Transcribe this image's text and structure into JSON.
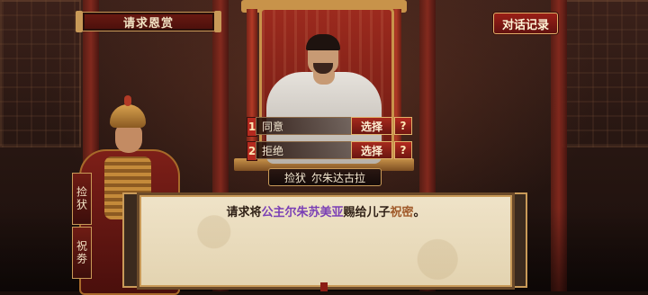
{
  "header": {
    "title": "请求恩赏",
    "dialog_log_label": "对话记录"
  },
  "options": [
    {
      "number": "1",
      "label": "同意",
      "select_label": "选择",
      "help_label": "?"
    },
    {
      "number": "2",
      "label": "拒绝",
      "select_label": "选择",
      "help_label": "?"
    }
  ],
  "speaker": {
    "title": "捡犾",
    "name": "尔朱达古拉"
  },
  "side_tags": {
    "tag1": "捡犾",
    "tag2": "祝劵"
  },
  "dialog": {
    "segments": [
      {
        "text": "请求将",
        "style": "plain"
      },
      {
        "text": "公主",
        "style": "purple"
      },
      {
        "text": "尔朱苏美亚",
        "style": "purple"
      },
      {
        "text": "赐给儿子",
        "style": "plain"
      },
      {
        "text": "祝密",
        "style": "brown"
      },
      {
        "text": "。",
        "style": "plain"
      }
    ]
  },
  "colors": {
    "accent_red": "#9a1f17",
    "gold_border": "#c99a58",
    "highlight_purple": "#7a3fb5",
    "highlight_brown": "#a05a2a"
  }
}
